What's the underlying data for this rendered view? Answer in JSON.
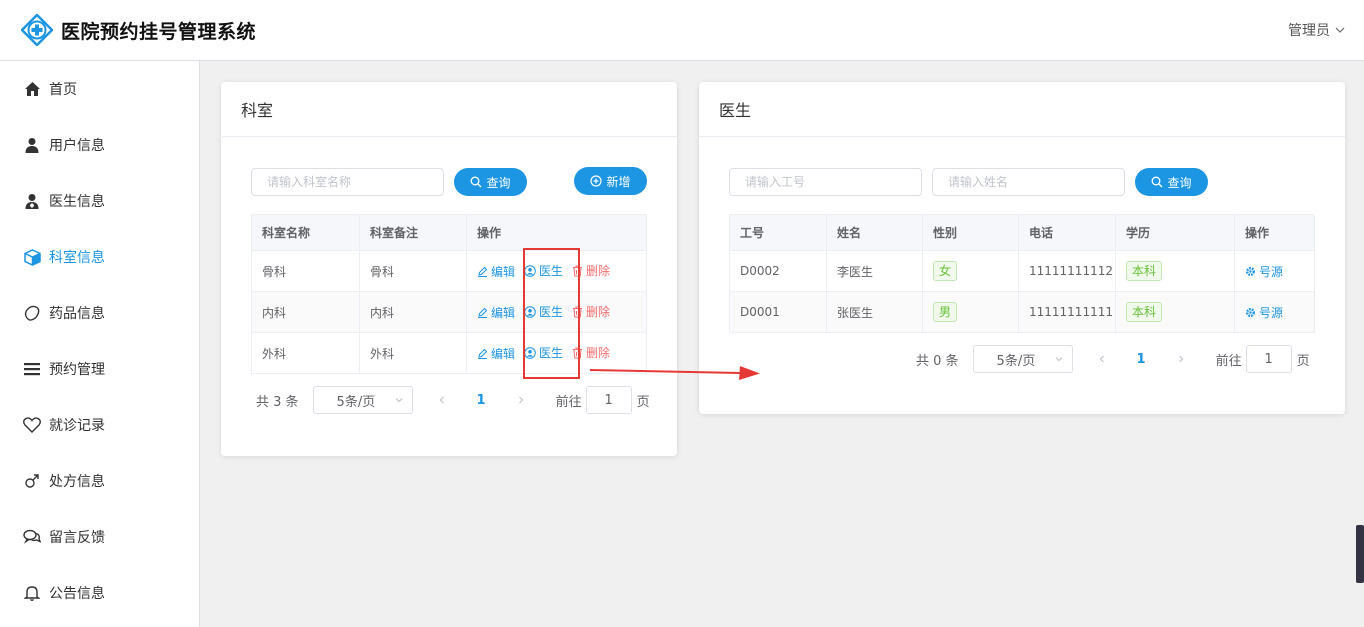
{
  "app": {
    "title": "医院预约挂号管理系统",
    "user": "管理员"
  },
  "sidebar": {
    "items": [
      {
        "label": "首页",
        "icon": "home-icon"
      },
      {
        "label": "用户信息",
        "icon": "user-icon"
      },
      {
        "label": "医生信息",
        "icon": "doctor-icon"
      },
      {
        "label": "科室信息",
        "icon": "cube-icon",
        "active": true
      },
      {
        "label": "药品信息",
        "icon": "capsule-icon"
      },
      {
        "label": "预约管理",
        "icon": "list-icon"
      },
      {
        "label": "就诊记录",
        "icon": "heart-icon"
      },
      {
        "label": "处方信息",
        "icon": "male-icon"
      },
      {
        "label": "留言反馈",
        "icon": "comments-icon"
      },
      {
        "label": "公告信息",
        "icon": "bell-icon"
      }
    ]
  },
  "dept": {
    "title": "科室",
    "search_placeholder": "请输入科室名称",
    "search_btn": "查询",
    "add_btn": "新增",
    "columns": [
      "科室名称",
      "科室备注",
      "操作"
    ],
    "rows": [
      {
        "name": "骨科",
        "note": "骨科"
      },
      {
        "name": "内科",
        "note": "内科"
      },
      {
        "name": "外科",
        "note": "外科"
      }
    ],
    "ops": {
      "edit": "编辑",
      "doctor": "医生",
      "delete": "删除"
    },
    "pager": {
      "total": "共 3 条",
      "size": "5条/页",
      "page": "1",
      "goto": "前往",
      "goto_value": "1",
      "unit": "页"
    }
  },
  "doctor": {
    "title": "医生",
    "id_placeholder": "请输入工号",
    "name_placeholder": "请输入姓名",
    "search_btn": "查询",
    "columns": [
      "工号",
      "姓名",
      "性别",
      "电话",
      "学历",
      "操作"
    ],
    "rows": [
      {
        "id": "D0002",
        "name": "李医生",
        "gender": "女",
        "phone": "11111111112",
        "edu": "本科"
      },
      {
        "id": "D0001",
        "name": "张医生",
        "gender": "男",
        "phone": "11111111111",
        "edu": "本科"
      }
    ],
    "op": "号源",
    "pager": {
      "total": "共 0 条",
      "size": "5条/页",
      "page": "1",
      "goto": "前往",
      "goto_value": "1",
      "unit": "页"
    }
  },
  "colors": {
    "primary": "#1c95e2",
    "danger": "#f56c6c",
    "success": "#67c23a",
    "annotation": "#e53935"
  }
}
